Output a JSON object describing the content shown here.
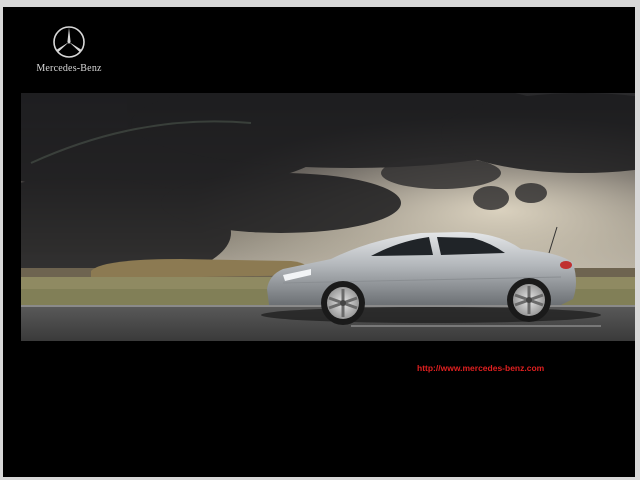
{
  "brand": {
    "name": "Mercedes-Benz",
    "logo_icon": "three-pointed-star-icon"
  },
  "hero": {
    "image": "silver-roadster-on-road-under-storm-clouds"
  },
  "footer": {
    "url": "http://www.mercedes-benz.com",
    "url_color": "#e02020"
  },
  "colors": {
    "background": "#000000",
    "frame": "#d8d8d8"
  }
}
